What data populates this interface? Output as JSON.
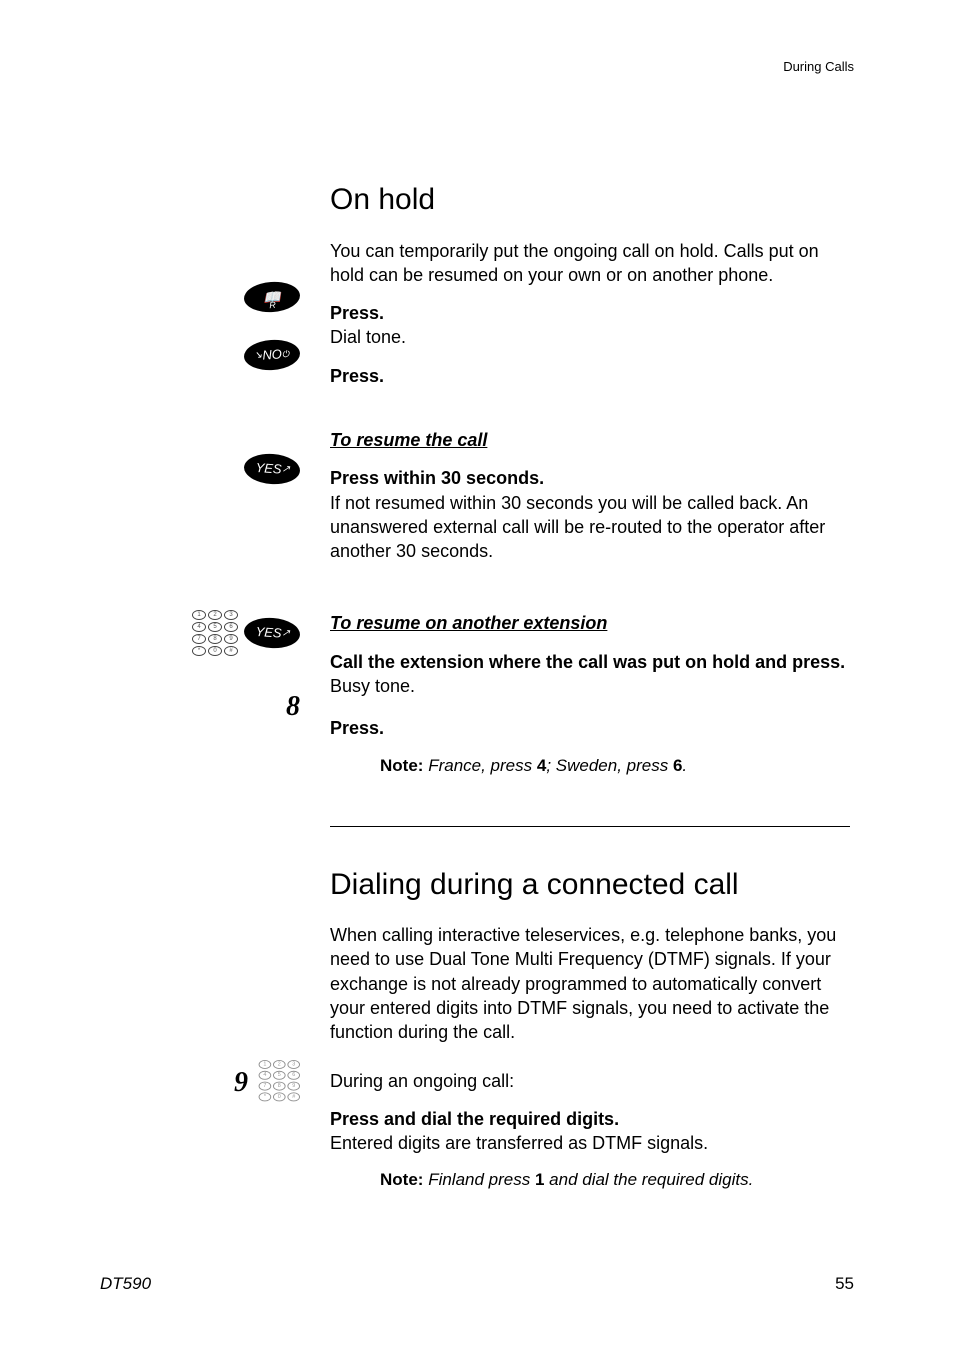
{
  "header": {
    "section": "During Calls"
  },
  "on_hold": {
    "title": "On hold",
    "intro": "You can temporarily put the ongoing call on hold. Calls put on hold can be resumed on your own or on another phone.",
    "step1": {
      "bold": "Press.",
      "text": "Dial tone."
    },
    "step2": {
      "bold": "Press."
    },
    "resume": {
      "heading": "To resume the call",
      "bold": "Press within 30 seconds.",
      "text": "If not resumed within 30 seconds you will be called back. An unanswered external call will be re-routed to the operator after another 30 seconds."
    },
    "resume_other": {
      "heading": "To resume on another extension",
      "step1_bold": "Call the extension where the call was put on hold and press.",
      "step1_text": "Busy tone.",
      "step2_digit": "8",
      "step2_bold": "Press.",
      "note_label": "Note:",
      "note_before": "France, press ",
      "note_d1": "4",
      "note_mid": "; Sweden, press ",
      "note_d2": "6",
      "note_after": "."
    }
  },
  "dialing": {
    "title": "Dialing during a connected call",
    "intro": "When calling interactive teleservices, e.g. telephone banks, you need to use Dual Tone Multi Frequency (DTMF) signals. If your exchange is not already programmed to automatically convert your entered digits into DTMF signals, you need to activate the function during the call.",
    "during": "During an ongoing call:",
    "digit": "9",
    "bold": "Press and dial the required digits.",
    "text": "Entered digits are transferred as DTMF signals.",
    "note_label": "Note:",
    "note_before": "Finland press ",
    "note_d": "1",
    "note_after": " and dial the required digits."
  },
  "footer": {
    "model": "DT590",
    "page": "55"
  },
  "labels": {
    "yes": "YES",
    "no": "NO",
    "r": "R",
    "power": "⏻"
  }
}
